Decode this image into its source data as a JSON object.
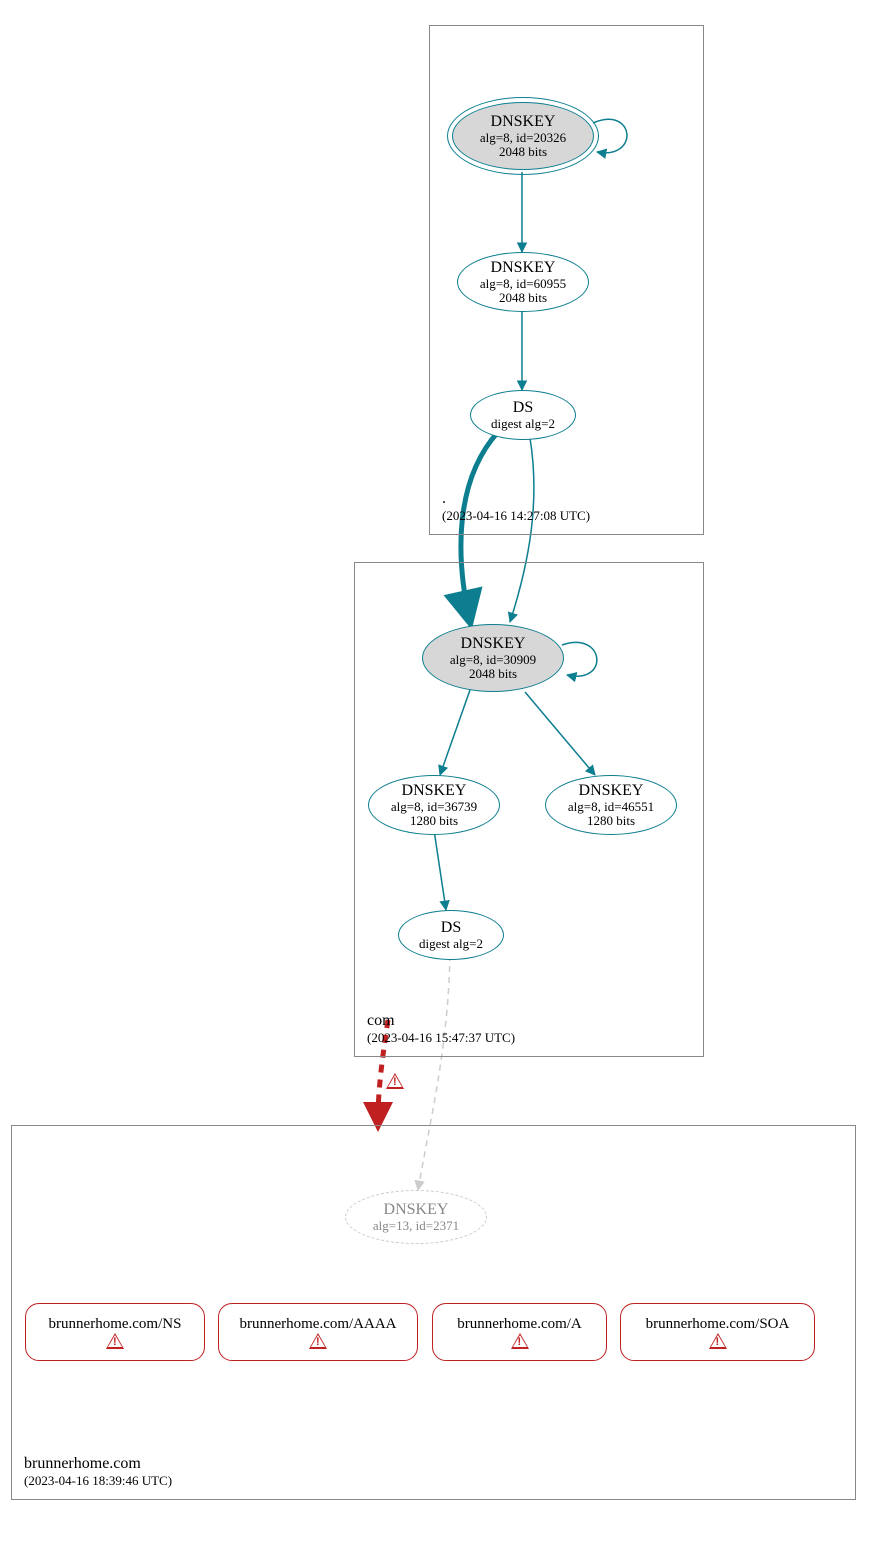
{
  "zones": {
    "root": {
      "name": ".",
      "timestamp": "(2023-04-16 14:27:08 UTC)"
    },
    "com": {
      "name": "com",
      "timestamp": "(2023-04-16 15:47:37 UTC)"
    },
    "domain": {
      "name": "brunnerhome.com",
      "timestamp": "(2023-04-16 18:39:46 UTC)"
    }
  },
  "nodes": {
    "root_ksk": {
      "title": "DNSKEY",
      "l1": "alg=8, id=20326",
      "l2": "2048 bits"
    },
    "root_zsk": {
      "title": "DNSKEY",
      "l1": "alg=8, id=60955",
      "l2": "2048 bits"
    },
    "root_ds": {
      "title": "DS",
      "l1": "digest alg=2"
    },
    "com_ksk": {
      "title": "DNSKEY",
      "l1": "alg=8, id=30909",
      "l2": "2048 bits"
    },
    "com_zsk1": {
      "title": "DNSKEY",
      "l1": "alg=8, id=36739",
      "l2": "1280 bits"
    },
    "com_zsk2": {
      "title": "DNSKEY",
      "l1": "alg=8, id=46551",
      "l2": "1280 bits"
    },
    "com_ds": {
      "title": "DS",
      "l1": "digest alg=2"
    },
    "dom_dnskey": {
      "title": "DNSKEY",
      "l1": "alg=13, id=2371"
    }
  },
  "rrsets": {
    "ns": "brunnerhome.com/NS",
    "aaaa": "brunnerhome.com/AAAA",
    "a": "brunnerhome.com/A",
    "soa": "brunnerhome.com/SOA"
  },
  "colors": {
    "secure": "#0d7e8f",
    "error": "#c02020",
    "faded": "#cccccc"
  },
  "chart_data": {
    "type": "graph",
    "description": "DNSSEC authentication chain diagram",
    "zones": [
      {
        "name": ".",
        "timestamp": "2023-04-16 14:27:08 UTC"
      },
      {
        "name": "com",
        "timestamp": "2023-04-16 15:47:37 UTC"
      },
      {
        "name": "brunnerhome.com",
        "timestamp": "2023-04-16 18:39:46 UTC"
      }
    ],
    "nodes": [
      {
        "id": "root_ksk",
        "zone": ".",
        "type": "DNSKEY",
        "alg": 8,
        "key_id": 20326,
        "bits": 2048,
        "role": "KSK",
        "trust_anchor": true
      },
      {
        "id": "root_zsk",
        "zone": ".",
        "type": "DNSKEY",
        "alg": 8,
        "key_id": 60955,
        "bits": 2048,
        "role": "ZSK"
      },
      {
        "id": "root_ds",
        "zone": ".",
        "type": "DS",
        "digest_alg": 2
      },
      {
        "id": "com_ksk",
        "zone": "com",
        "type": "DNSKEY",
        "alg": 8,
        "key_id": 30909,
        "bits": 2048,
        "role": "KSK"
      },
      {
        "id": "com_zsk1",
        "zone": "com",
        "type": "DNSKEY",
        "alg": 8,
        "key_id": 36739,
        "bits": 1280,
        "role": "ZSK"
      },
      {
        "id": "com_zsk2",
        "zone": "com",
        "type": "DNSKEY",
        "alg": 8,
        "key_id": 46551,
        "bits": 1280,
        "role": "ZSK"
      },
      {
        "id": "com_ds",
        "zone": "com",
        "type": "DS",
        "digest_alg": 2
      },
      {
        "id": "dom_dnskey",
        "zone": "brunnerhome.com",
        "type": "DNSKEY",
        "alg": 13,
        "key_id": 2371,
        "status": "not-found"
      },
      {
        "id": "dom_ns",
        "zone": "brunnerhome.com",
        "type": "RRset",
        "name": "brunnerhome.com/NS",
        "status": "bogus"
      },
      {
        "id": "dom_aaaa",
        "zone": "brunnerhome.com",
        "type": "RRset",
        "name": "brunnerhome.com/AAAA",
        "status": "bogus"
      },
      {
        "id": "dom_a",
        "zone": "brunnerhome.com",
        "type": "RRset",
        "name": "brunnerhome.com/A",
        "status": "bogus"
      },
      {
        "id": "dom_soa",
        "zone": "brunnerhome.com",
        "type": "RRset",
        "name": "brunnerhome.com/SOA",
        "status": "bogus"
      }
    ],
    "edges": [
      {
        "from": "root_ksk",
        "to": "root_ksk",
        "status": "secure",
        "self_loop": true
      },
      {
        "from": "root_ksk",
        "to": "root_zsk",
        "status": "secure"
      },
      {
        "from": "root_zsk",
        "to": "root_ds",
        "status": "secure"
      },
      {
        "from": "root_ds",
        "to": "com_ksk",
        "status": "secure"
      },
      {
        "from": "com_ksk",
        "to": "com_ksk",
        "status": "secure",
        "self_loop": true
      },
      {
        "from": "com_ksk",
        "to": "com_zsk1",
        "status": "secure"
      },
      {
        "from": "com_ksk",
        "to": "com_zsk2",
        "status": "secure"
      },
      {
        "from": "com_zsk1",
        "to": "com_ds",
        "status": "secure"
      },
      {
        "from": "com_ds",
        "to": "dom_dnskey",
        "status": "insecure",
        "style": "dashed-gray"
      },
      {
        "from": "com",
        "to": "brunnerhome.com",
        "status": "error",
        "style": "dashed-red-thick",
        "type": "delegation"
      }
    ]
  }
}
